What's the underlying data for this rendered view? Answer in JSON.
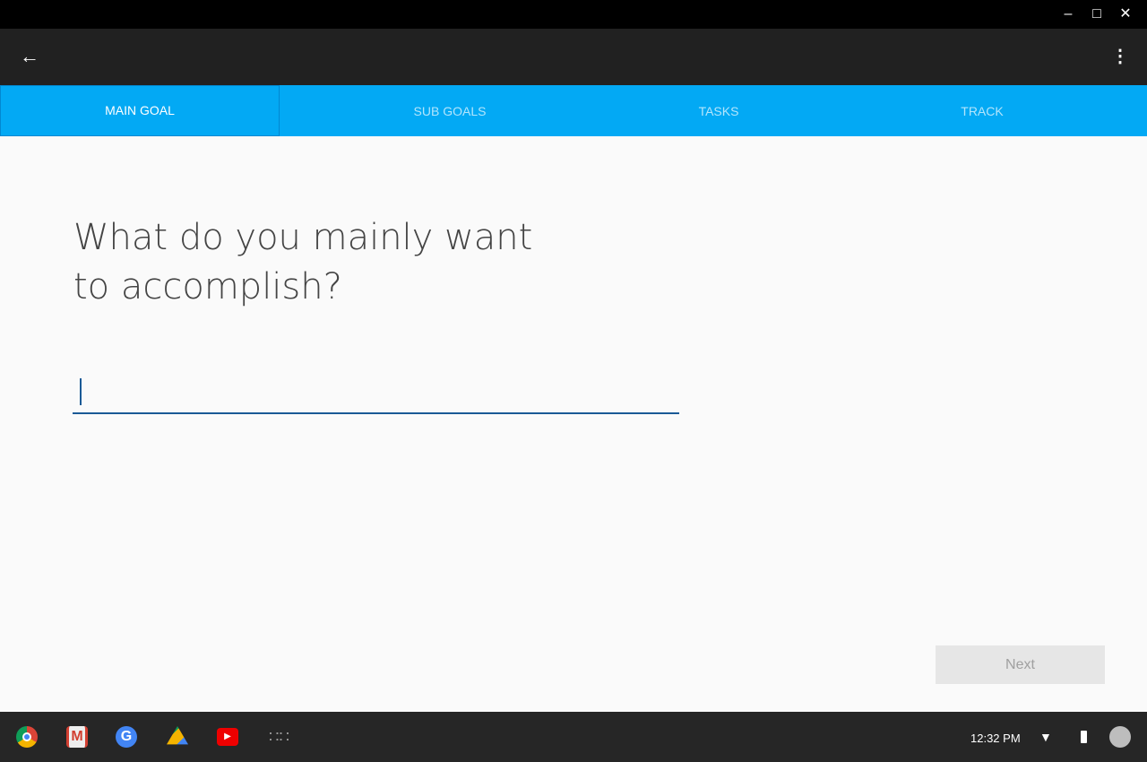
{
  "window": {
    "controls": [
      "minimize",
      "maximize",
      "close"
    ]
  },
  "appbar": {
    "back_icon": "arrow-left",
    "menu_icon": "more-vert"
  },
  "tabs": [
    {
      "label": "MAIN GOAL",
      "active": true
    },
    {
      "label": "SUB GOALS"
    },
    {
      "label": "TASKS"
    },
    {
      "label": "TRACK"
    }
  ],
  "main": {
    "question": "What do you mainly want to accomplish?",
    "input_value": "",
    "next_label": "Next"
  },
  "shelf": {
    "apps": [
      "chrome",
      "gmail",
      "google",
      "drive",
      "youtube",
      "launcher"
    ],
    "time": "12:32 PM"
  },
  "colors": {
    "tab_bar": "#03a9f4",
    "appbar": "#212121",
    "input_accent": "#1a5a96"
  }
}
